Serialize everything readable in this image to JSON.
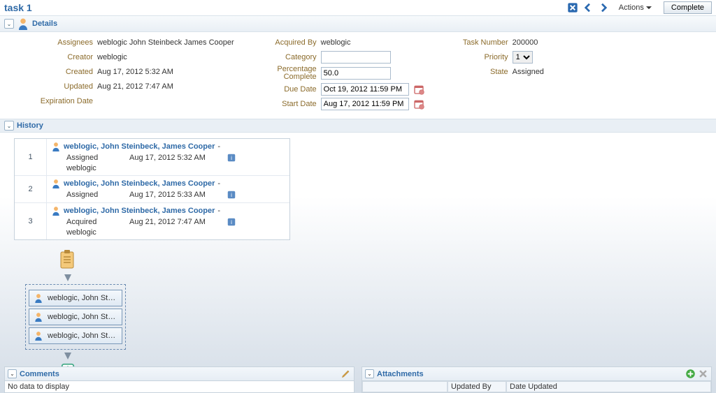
{
  "header": {
    "title": "task 1",
    "actions_label": "Actions",
    "complete_label": "Complete"
  },
  "details": {
    "section_label": "Details",
    "left": {
      "assignees_label": "Assignees",
      "assignees_value": "weblogic John Steinbeck James Cooper",
      "creator_label": "Creator",
      "creator_value": "weblogic",
      "created_label": "Created",
      "created_value": "Aug 17, 2012 5:32 AM",
      "updated_label": "Updated",
      "updated_value": "Aug 21, 2012 7:47 AM",
      "expiration_label": "Expiration Date",
      "expiration_value": ""
    },
    "mid": {
      "acquired_by_label": "Acquired By",
      "acquired_by_value": "weblogic",
      "category_label": "Category",
      "category_value": "",
      "pct_label": "Percentage Complete",
      "pct_value": "50.0",
      "due_label": "Due Date",
      "due_value": "Oct 19, 2012 11:59 PM",
      "start_label": "Start Date",
      "start_value": "Aug 17, 2012 11:59 PM"
    },
    "right": {
      "task_num_label": "Task Number",
      "task_num_value": "200000",
      "priority_label": "Priority",
      "priority_value": "1",
      "state_label": "State",
      "state_value": "Assigned"
    }
  },
  "history": {
    "section_label": "History",
    "rows": [
      {
        "num": "1",
        "title": "weblogic, John Steinbeck, James Cooper",
        "action": "Assigned",
        "date": "Aug 17, 2012 5:32 AM",
        "user": "weblogic"
      },
      {
        "num": "2",
        "title": "weblogic, John Steinbeck, James Cooper",
        "action": "Assigned",
        "date": "Aug 17, 2012 5:33 AM",
        "user": ""
      },
      {
        "num": "3",
        "title": "weblogic, John Steinbeck, James Cooper",
        "action": "Acquired",
        "date": "Aug 21, 2012 7:47 AM",
        "user": "weblogic"
      }
    ],
    "flow_nodes": [
      "weblogic, John Ste...",
      "weblogic, John Ste...",
      "weblogic, John Ste..."
    ]
  },
  "comments": {
    "section_label": "Comments",
    "empty_text": "No data to display"
  },
  "attachments": {
    "section_label": "Attachments",
    "col_name": "",
    "col_updated_by": "Updated By",
    "col_date_updated": "Date Updated"
  }
}
